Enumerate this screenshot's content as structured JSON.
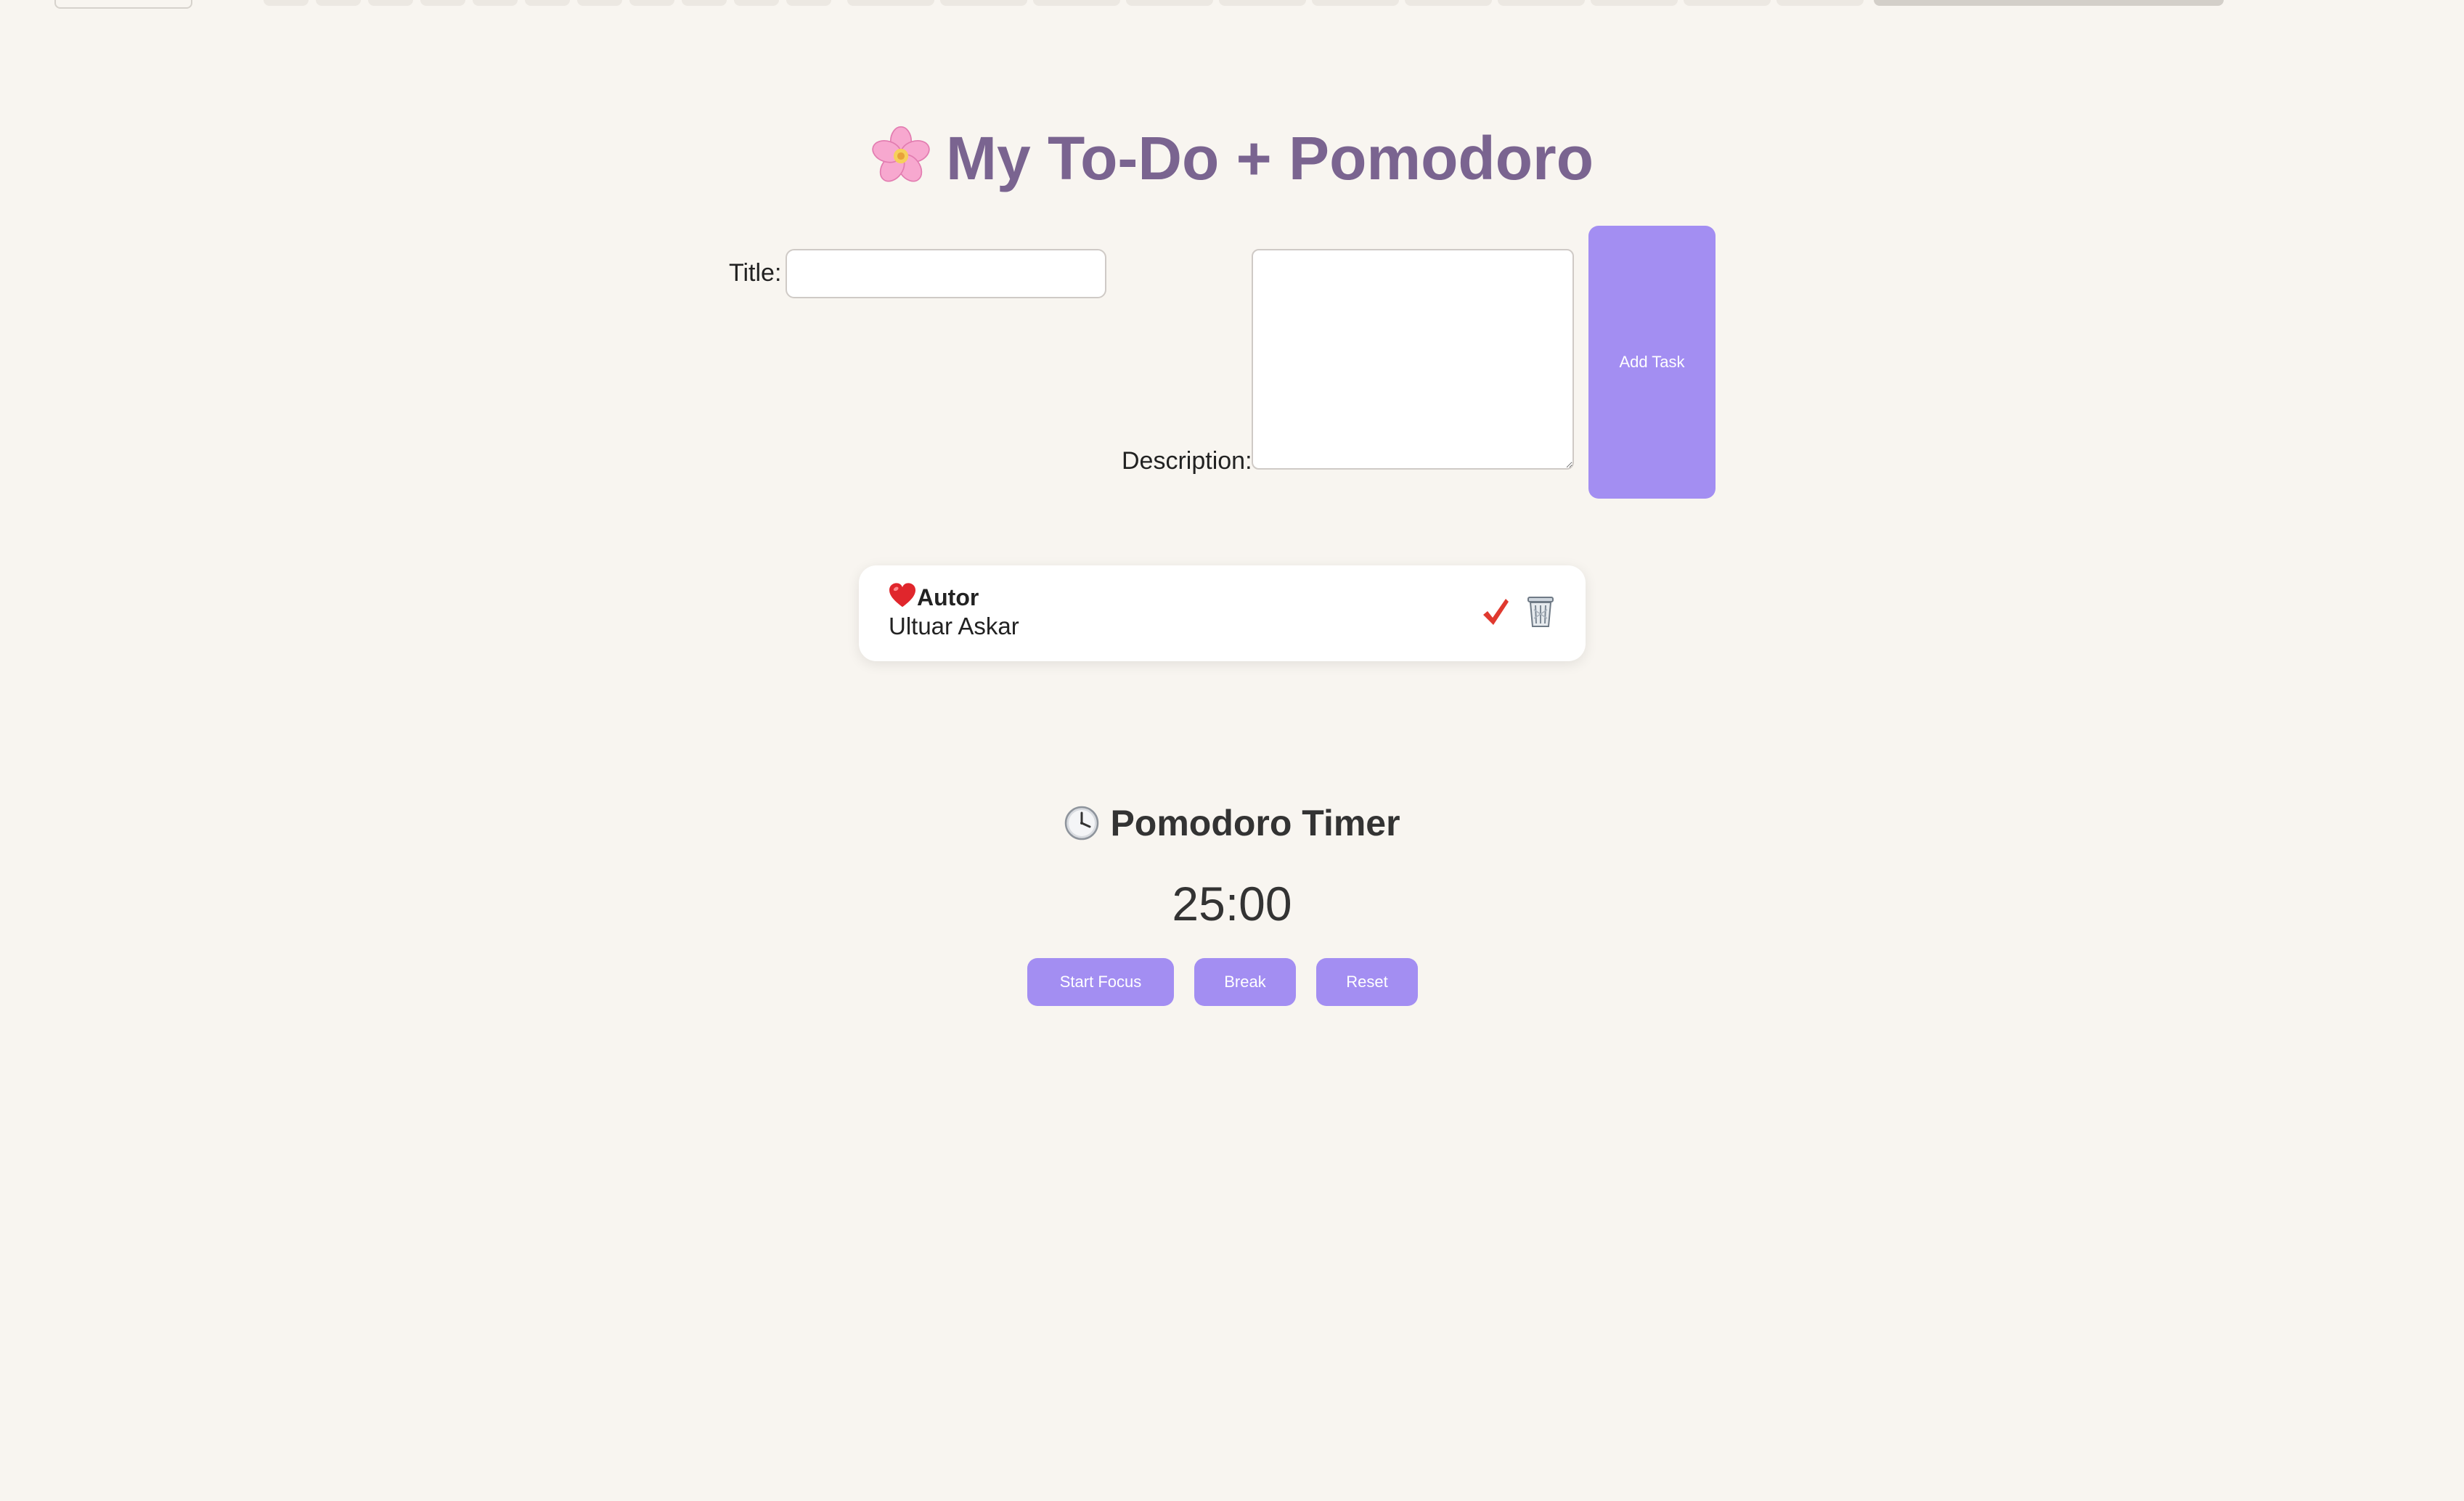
{
  "app": {
    "title": "My To-Do + Pomodoro",
    "title_icon": "cherry-blossom-icon",
    "accent_color": "#a38ef2",
    "title_color": "#7a6490"
  },
  "form": {
    "title_label": "Title:",
    "title_value": "",
    "description_label": "Description:",
    "description_value": "",
    "add_button_label": "Add Task"
  },
  "tasks": [
    {
      "icon": "red-heart-icon",
      "title": "Autor",
      "description": "Ultuar Askar",
      "complete_icon": "check-mark-icon",
      "delete_icon": "trash-can-icon"
    }
  ],
  "pomodoro": {
    "title": "Pomodoro Timer",
    "title_icon": "clock-icon",
    "time": "25:00",
    "start_label": "Start Focus",
    "break_label": "Break",
    "reset_label": "Reset"
  }
}
